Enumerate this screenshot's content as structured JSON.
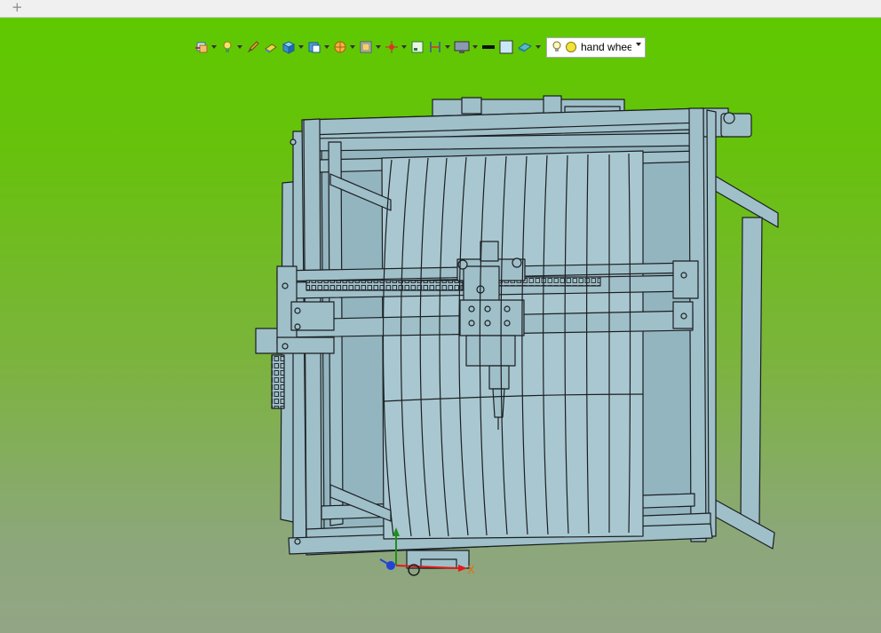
{
  "tabstrip": {
    "new_tab_glyph": "+"
  },
  "toolbar": {
    "buttons": [
      {
        "name": "layer-icon",
        "dropdown": true
      },
      {
        "name": "light-bulb-icon",
        "dropdown": true
      },
      {
        "name": "pencil-icon",
        "dropdown": false
      },
      {
        "name": "eraser-icon",
        "dropdown": false
      },
      {
        "name": "cube-icon",
        "dropdown": true
      },
      {
        "name": "view-cube-icon",
        "dropdown": true
      },
      {
        "name": "section-icon",
        "dropdown": true
      },
      {
        "name": "display-mode-icon",
        "dropdown": true
      },
      {
        "name": "origin-icon",
        "dropdown": true
      },
      {
        "name": "frame-icon",
        "dropdown": false
      },
      {
        "name": "dimension-icon",
        "dropdown": true
      },
      {
        "name": "monitor-icon",
        "dropdown": true
      },
      {
        "name": "line-color-icon",
        "dropdown": false
      },
      {
        "name": "background-color-icon",
        "dropdown": false
      },
      {
        "name": "appearance-icon",
        "dropdown": true
      }
    ],
    "scene_combo": {
      "value": "hand whee",
      "icons": [
        "bulb-icon",
        "sun-icon"
      ]
    }
  },
  "triad": {
    "x_label": "X"
  },
  "colors": {
    "viewport_top": "#5fc900",
    "viewport_bottom": "#93a585",
    "model_fill": "#9fbfc9",
    "model_stroke": "#1b1f22",
    "triad_x": "#e11b1b",
    "triad_y": "#1e8f1e",
    "triad_z": "#2044d6"
  }
}
